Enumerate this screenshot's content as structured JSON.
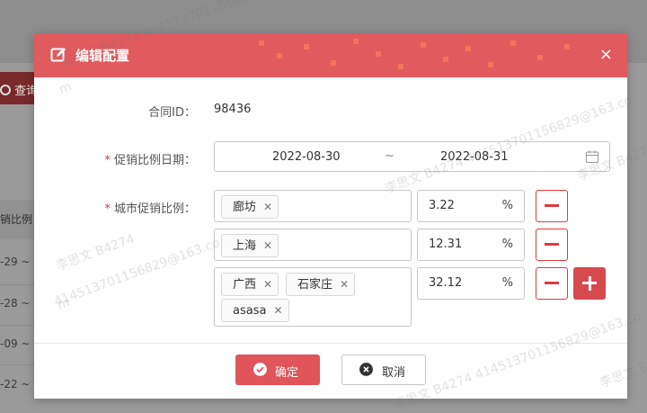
{
  "background": {
    "query_label": "查询",
    "column_header": "销比例",
    "row_fragments": [
      "-29 ~",
      "-28 ~",
      "-09 ~",
      "-22 ~"
    ]
  },
  "dialog": {
    "title": "编辑配置",
    "close_symbol": "×",
    "contract": {
      "label": "合同ID：",
      "value": "98436"
    },
    "promo_date": {
      "label": "促销比例日期：",
      "start": "2022-08-30",
      "separator": "~",
      "end": "2022-08-31"
    },
    "city_ratio": {
      "label": "城市促销比例：",
      "rows": [
        {
          "cities": [
            "廊坊"
          ],
          "percent": "3.22",
          "unit": "%"
        },
        {
          "cities": [
            "上海"
          ],
          "percent": "12.31",
          "unit": "%"
        },
        {
          "cities": [
            "广西",
            "石家庄",
            "asasa"
          ],
          "percent": "32.12",
          "unit": "%"
        }
      ]
    },
    "buttons": {
      "confirm": "确定",
      "cancel": "取消"
    }
  },
  "watermark": {
    "name": "李思文 B4274",
    "number": "414513701156829@163.co",
    "tail": "m"
  },
  "colors": {
    "accent": "#e0545a",
    "danger": "#e0393e",
    "header": "#e05a5e"
  }
}
